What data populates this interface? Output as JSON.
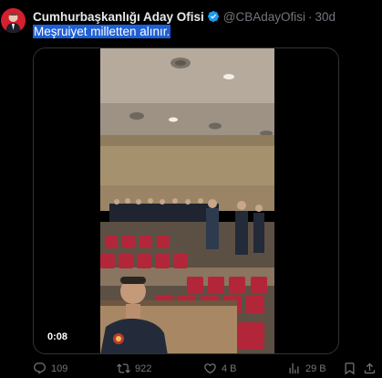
{
  "post": {
    "author": {
      "display_name": "Cumhurbaşkanlığı Aday Ofisi",
      "handle": "@CBAdayOfisi",
      "verified": true
    },
    "separator": "·",
    "timestamp": "30d",
    "text": "Meşruiyet milletten alınır."
  },
  "media": {
    "type": "video",
    "duration": "0:08"
  },
  "actions": {
    "replies": "109",
    "reposts": "922",
    "likes": "4 B",
    "views": "29 B"
  },
  "colors": {
    "background": "#000000",
    "text_primary": "#e7e9ea",
    "text_secondary": "#71767b",
    "verified_badge": "#1d9bf0",
    "selection_highlight": "#1d5fd6",
    "border": "#2f3336"
  },
  "icons": [
    "avatar",
    "verified-badge-icon",
    "reply-icon",
    "repost-icon",
    "like-icon",
    "views-icon",
    "bookmark-icon",
    "share-icon"
  ]
}
